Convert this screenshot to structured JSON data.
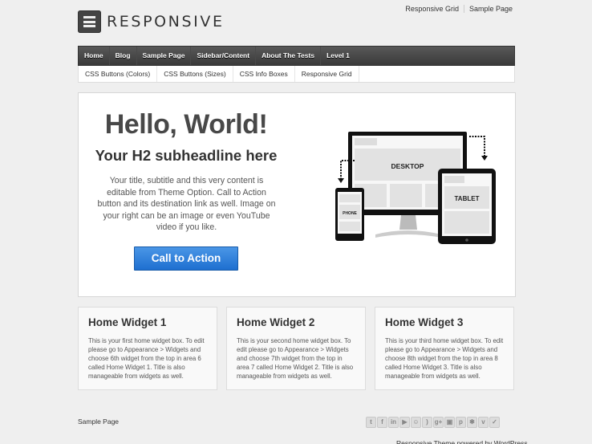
{
  "site": {
    "logo_text": "RESPONSIVE",
    "logo_icon": "hamburger-menu-icon"
  },
  "top_menu": {
    "items": [
      {
        "label": "Responsive Grid"
      },
      {
        "label": "Sample Page"
      }
    ]
  },
  "main_nav": {
    "items": [
      {
        "label": "Home"
      },
      {
        "label": "Blog"
      },
      {
        "label": "Sample Page"
      },
      {
        "label": "Sidebar/Content"
      },
      {
        "label": "About The Tests"
      },
      {
        "label": "Level 1"
      }
    ]
  },
  "sub_nav": {
    "items": [
      {
        "label": "CSS Buttons (Colors)"
      },
      {
        "label": "CSS Buttons (Sizes)"
      },
      {
        "label": "CSS Info Boxes"
      },
      {
        "label": "Responsive Grid"
      }
    ]
  },
  "hero": {
    "title": "Hello, World!",
    "subtitle": "Your H2 subheadline here",
    "body": "Your title, subtitle and this very content is editable from Theme Option. Call to Action button and its destination link as well. Image on your right can be an image or even YouTube video if you like.",
    "cta_label": "Call to Action",
    "cta_color": "#2a7fde",
    "image_labels": {
      "desktop": "DESKTOP",
      "tablet": "TABLET",
      "phone": "PHONE"
    }
  },
  "widgets": [
    {
      "title": "Home Widget 1",
      "body": "This is your first home widget box. To edit please go to Appearance > Widgets and choose 6th widget from the top in area 6 called Home Widget 1. Title is also manageable from widgets as well."
    },
    {
      "title": "Home Widget 2",
      "body": "This is your second home widget box. To edit please go to Appearance > Widgets and choose 7th widget from the top in area 7 called Home Widget 2. Title is also manageable from widgets as well."
    },
    {
      "title": "Home Widget 3",
      "body": "This is your third home widget box. To edit please go to Appearance > Widgets and choose 8th widget from the top in area 8 called Home Widget 3. Title is also manageable from widgets as well."
    }
  ],
  "footer": {
    "link": "Sample Page",
    "social": [
      {
        "name": "twitter-icon",
        "glyph": "t"
      },
      {
        "name": "facebook-icon",
        "glyph": "f"
      },
      {
        "name": "linkedin-icon",
        "glyph": "in"
      },
      {
        "name": "youtube-icon",
        "glyph": "▶"
      },
      {
        "name": "stumbleupon-icon",
        "glyph": "☺"
      },
      {
        "name": "rss-icon",
        "glyph": ")"
      },
      {
        "name": "google-plus-icon",
        "glyph": "g+"
      },
      {
        "name": "instagram-icon",
        "glyph": "▣"
      },
      {
        "name": "pinterest-icon",
        "glyph": "p"
      },
      {
        "name": "yelp-icon",
        "glyph": "✱"
      },
      {
        "name": "vimeo-icon",
        "glyph": "v"
      },
      {
        "name": "foursquare-icon",
        "glyph": "✓"
      }
    ],
    "credits": "Responsive Theme powered by WordPress"
  }
}
